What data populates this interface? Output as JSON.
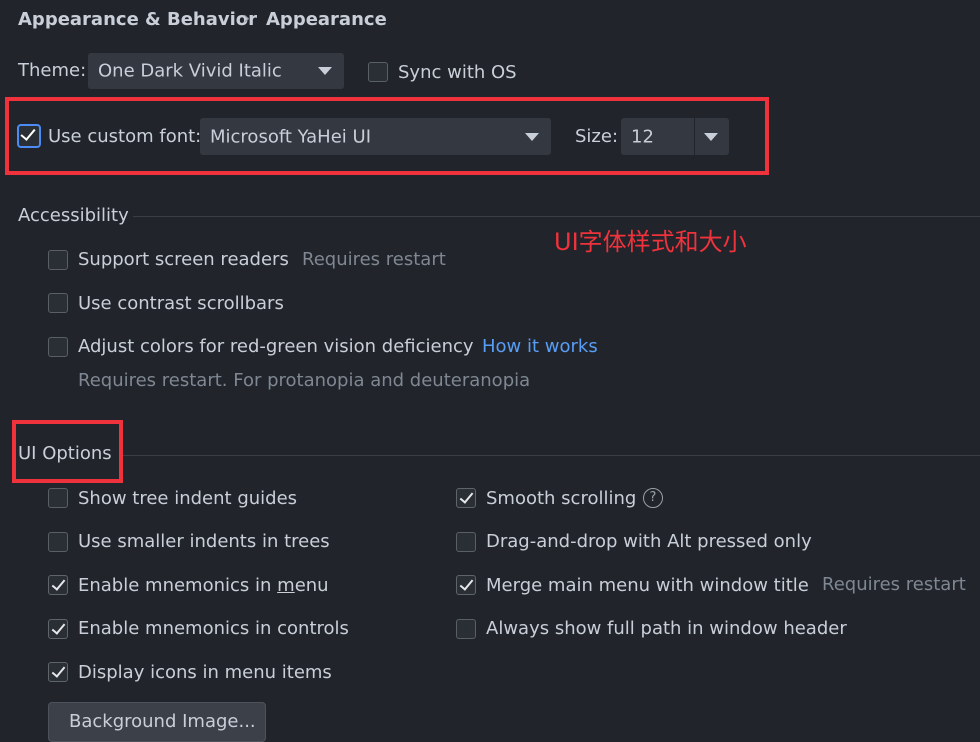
{
  "breadcrumb": {
    "parent": "Appearance & Behavior",
    "separator": "›",
    "current": "Appearance"
  },
  "theme": {
    "label": "Theme:",
    "value": "One Dark Vivid Italic",
    "sync_label": "Sync with OS",
    "sync_checked": false
  },
  "font": {
    "use_custom_label": "Use custom font:",
    "use_custom_checked": true,
    "family": "Microsoft YaHei UI",
    "size_label": "Size:",
    "size_value": "12"
  },
  "annotation": {
    "text": "UI字体样式和大小",
    "color": "#f0323c"
  },
  "accessibility": {
    "title": "Accessibility",
    "screen_readers": {
      "label": "Support screen readers",
      "note": "Requires restart",
      "checked": false
    },
    "contrast_scrollbars": {
      "label": "Use contrast scrollbars",
      "checked": false
    },
    "color_adjust": {
      "label": "Adjust colors for red-green vision deficiency",
      "link": "How it works",
      "note": "Requires restart. For protanopia and deuteranopia",
      "checked": false
    }
  },
  "ui_options": {
    "title": "UI Options",
    "left": [
      {
        "label": "Show tree indent guides",
        "checked": false
      },
      {
        "label": "Use smaller indents in trees",
        "checked": false
      },
      {
        "label_pre": "Enable mnemonics in ",
        "label_u": "m",
        "label_post": "enu",
        "checked": true
      },
      {
        "label": "Enable mnemonics in controls",
        "checked": true
      },
      {
        "label": "Display icons in menu items",
        "checked": true
      }
    ],
    "right": [
      {
        "label": "Smooth scrolling",
        "checked": true,
        "help": "?"
      },
      {
        "label": "Drag-and-drop with Alt pressed only",
        "checked": false
      },
      {
        "label": "Merge main menu with window title",
        "checked": true,
        "note": "Requires restart"
      },
      {
        "label": "Always show full path in window header",
        "checked": false
      }
    ],
    "background_button": "Background Image..."
  },
  "colors": {
    "background": "#21252b",
    "accent": "#4c8bf5",
    "link": "#589df6",
    "highlight": "#f0323c"
  }
}
